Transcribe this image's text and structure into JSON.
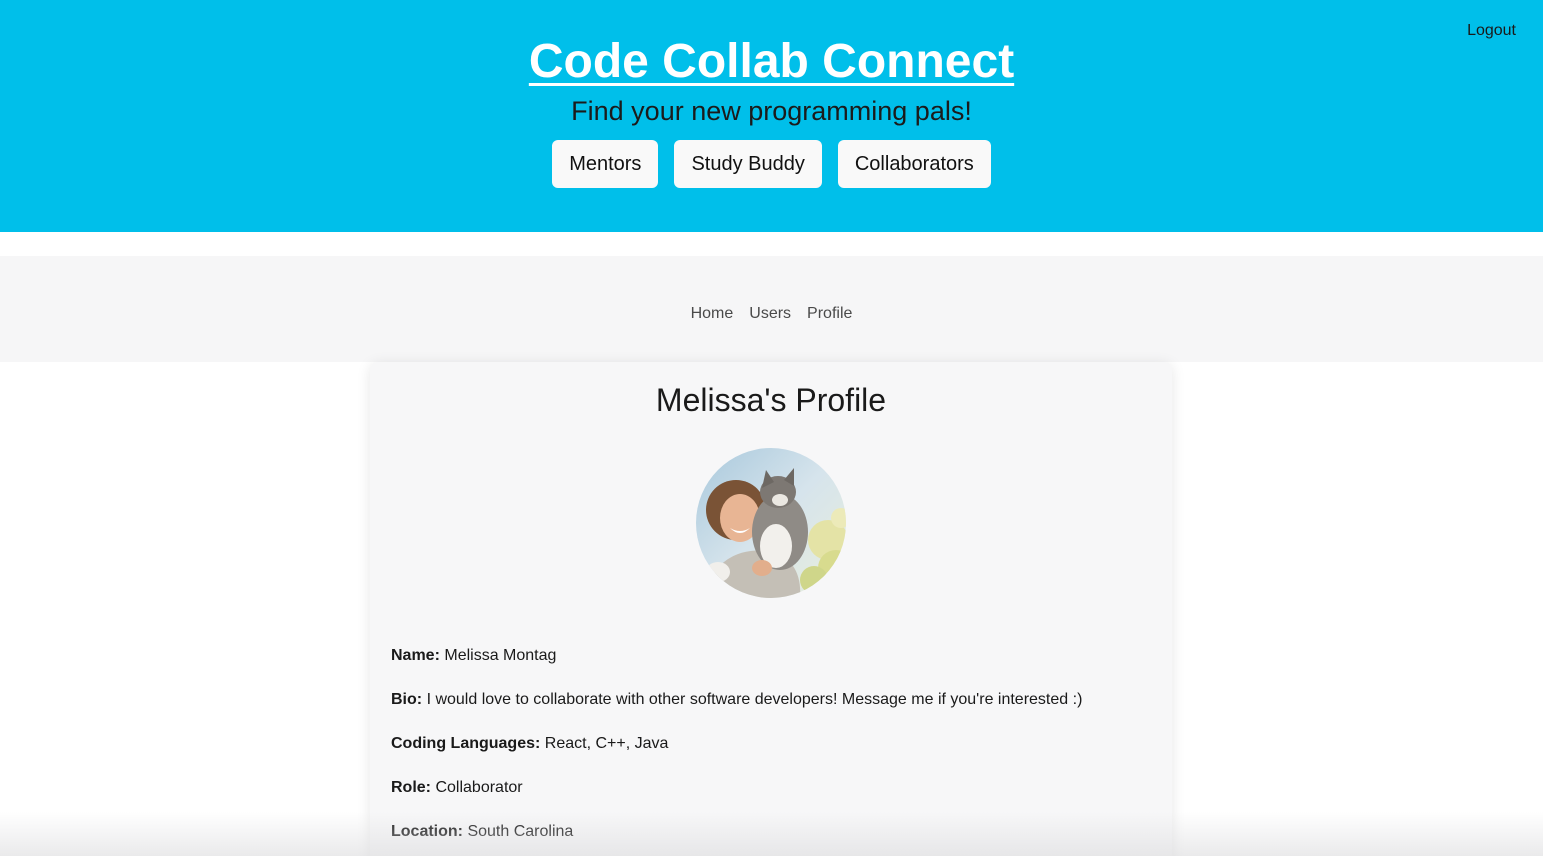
{
  "header": {
    "title": "Code Collab Connect",
    "tagline": "Find your new programming pals!",
    "logout_label": "Logout",
    "role_buttons": [
      "Mentors",
      "Study Buddy",
      "Collaborators"
    ],
    "colors": {
      "hero_bg": "#00bfea",
      "button_bg": "#f9f9f9"
    }
  },
  "nav": {
    "items": [
      "Home",
      "Users",
      "Profile"
    ]
  },
  "profile": {
    "heading": "Melissa's Profile",
    "avatar_icon": "profile-photo",
    "fields": [
      {
        "label": "Name:",
        "value": "Melissa Montag"
      },
      {
        "label": "Bio:",
        "value": "I would love to collaborate with other software developers! Message me if you're interested :)"
      },
      {
        "label": "Coding Languages:",
        "value": "React, C++, Java"
      },
      {
        "label": "Role:",
        "value": "Collaborator"
      },
      {
        "label": "Location:",
        "value": "South Carolina"
      }
    ]
  }
}
